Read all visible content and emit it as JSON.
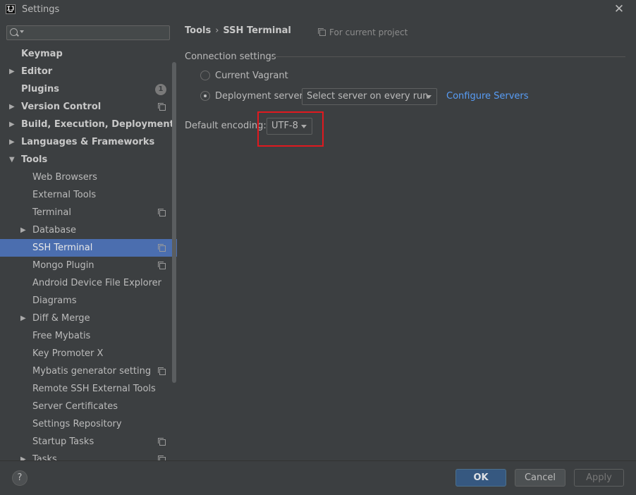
{
  "window": {
    "title": "Settings",
    "close_glyph": "✕"
  },
  "search": {
    "placeholder": "",
    "value": ""
  },
  "sidebar": {
    "items": [
      {
        "label": "Keymap",
        "level": 0,
        "bold": true
      },
      {
        "label": "Editor",
        "level": 0,
        "bold": true,
        "arrow": "▶"
      },
      {
        "label": "Plugins",
        "level": 0,
        "bold": true,
        "badge": "1"
      },
      {
        "label": "Version Control",
        "level": 0,
        "bold": true,
        "arrow": "▶",
        "copy_icon": true
      },
      {
        "label": "Build, Execution, Deployment",
        "level": 0,
        "bold": true,
        "arrow": "▶"
      },
      {
        "label": "Languages & Frameworks",
        "level": 0,
        "bold": true,
        "arrow": "▶"
      },
      {
        "label": "Tools",
        "level": 0,
        "bold": true,
        "arrow": "▼"
      },
      {
        "label": "Web Browsers",
        "level": 1
      },
      {
        "label": "External Tools",
        "level": 1
      },
      {
        "label": "Terminal",
        "level": 1,
        "copy_icon": true
      },
      {
        "label": "Database",
        "level": 1,
        "arrow": "▶"
      },
      {
        "label": "SSH Terminal",
        "level": 1,
        "selected": true,
        "copy_icon": true
      },
      {
        "label": "Mongo Plugin",
        "level": 1,
        "copy_icon": true
      },
      {
        "label": "Android Device File Explorer",
        "level": 1
      },
      {
        "label": "Diagrams",
        "level": 1
      },
      {
        "label": "Diff & Merge",
        "level": 1,
        "arrow": "▶"
      },
      {
        "label": "Free Mybatis",
        "level": 1
      },
      {
        "label": "Key Promoter X",
        "level": 1
      },
      {
        "label": "Mybatis generator setting",
        "level": 1,
        "copy_icon": true
      },
      {
        "label": "Remote SSH External Tools",
        "level": 1
      },
      {
        "label": "Server Certificates",
        "level": 1
      },
      {
        "label": "Settings Repository",
        "level": 1
      },
      {
        "label": "Startup Tasks",
        "level": 1,
        "copy_icon": true
      },
      {
        "label": "Tasks",
        "level": 1,
        "arrow": "▶",
        "copy_icon": true
      }
    ]
  },
  "breadcrumb": {
    "parent": "Tools",
    "separator": "›",
    "current": "SSH Terminal"
  },
  "scope": {
    "label": "For current project"
  },
  "connection": {
    "section_title": "Connection settings",
    "option_vagrant": "Current Vagrant",
    "option_deployment": "Deployment server",
    "selected_option": "Deployment server",
    "server_select_value": "Select server on every run",
    "configure_link": "Configure Servers"
  },
  "encoding": {
    "label": "Default encoding:",
    "value": "UTF-8"
  },
  "footer": {
    "help": "?",
    "ok": "OK",
    "cancel": "Cancel",
    "apply": "Apply"
  },
  "colors": {
    "accent": "#4b6eaf",
    "link": "#589df6",
    "highlight": "#e0191f",
    "background": "#3c3f41"
  }
}
